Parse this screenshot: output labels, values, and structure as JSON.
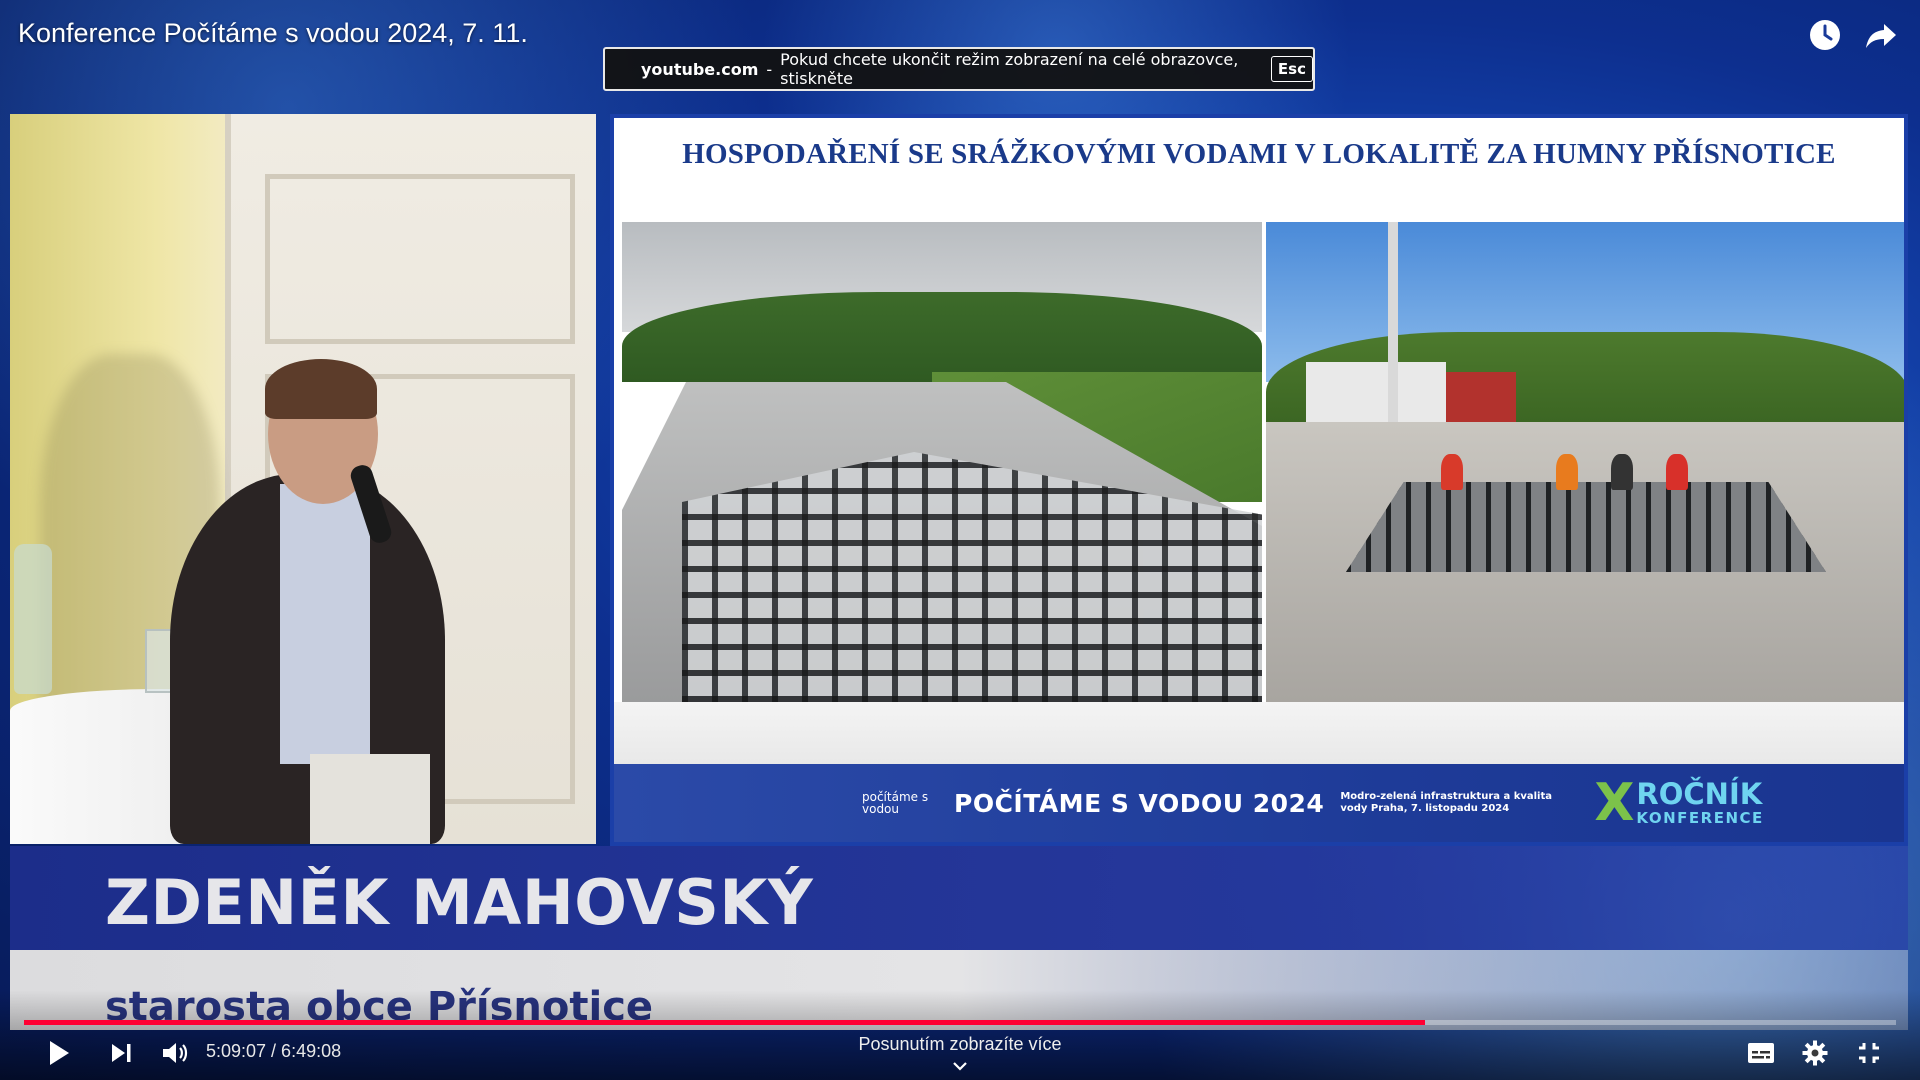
{
  "video": {
    "title": "Konference Počítáme s vodou 2024, 7. 11.",
    "progress_fraction": 0.7485,
    "current_time": "5:09:07",
    "duration": "6:49:08",
    "time_display": "5:09:07 / 6:49:08",
    "scroll_hint": "Posunutím zobrazíte více"
  },
  "fullscreen_notice": {
    "domain": "youtube.com",
    "separator": "-",
    "message": "Pokud chcete ukončit režim zobrazení na celé obrazovce, stiskněte",
    "key": "Esc"
  },
  "slide": {
    "title": "HOSPODAŘENÍ SE SRÁŽKOVÝMI VODAMI V LOKALITĚ ZA HUMNY PŘÍSNOTICE",
    "banner": {
      "logo_text": "počítáme s vodou",
      "event": "POČÍTÁME S VODOU 2024",
      "subtitle": "Modro-zelená infrastruktura a kvalita vody Praha, 7. listopadu 2024",
      "edition_mark": "X",
      "edition_word": "ROČNÍK",
      "edition_sub": "KONFERENCE"
    }
  },
  "lower_third": {
    "name": "ZDENĚK MAHOVSKÝ",
    "role": "starosta obce Přísnotice"
  },
  "icons": {
    "top": [
      "watch-later-icon",
      "share-icon"
    ],
    "controls_left": [
      "play-icon",
      "next-icon",
      "volume-icon"
    ],
    "controls_right": [
      "subtitles-icon",
      "settings-icon",
      "exit-fullscreen-icon"
    ]
  },
  "colors": {
    "progress_played": "#ff0033",
    "name_band": "#1c2d8a",
    "role_text": "#27337f",
    "slide_title": "#1a3a8a"
  }
}
